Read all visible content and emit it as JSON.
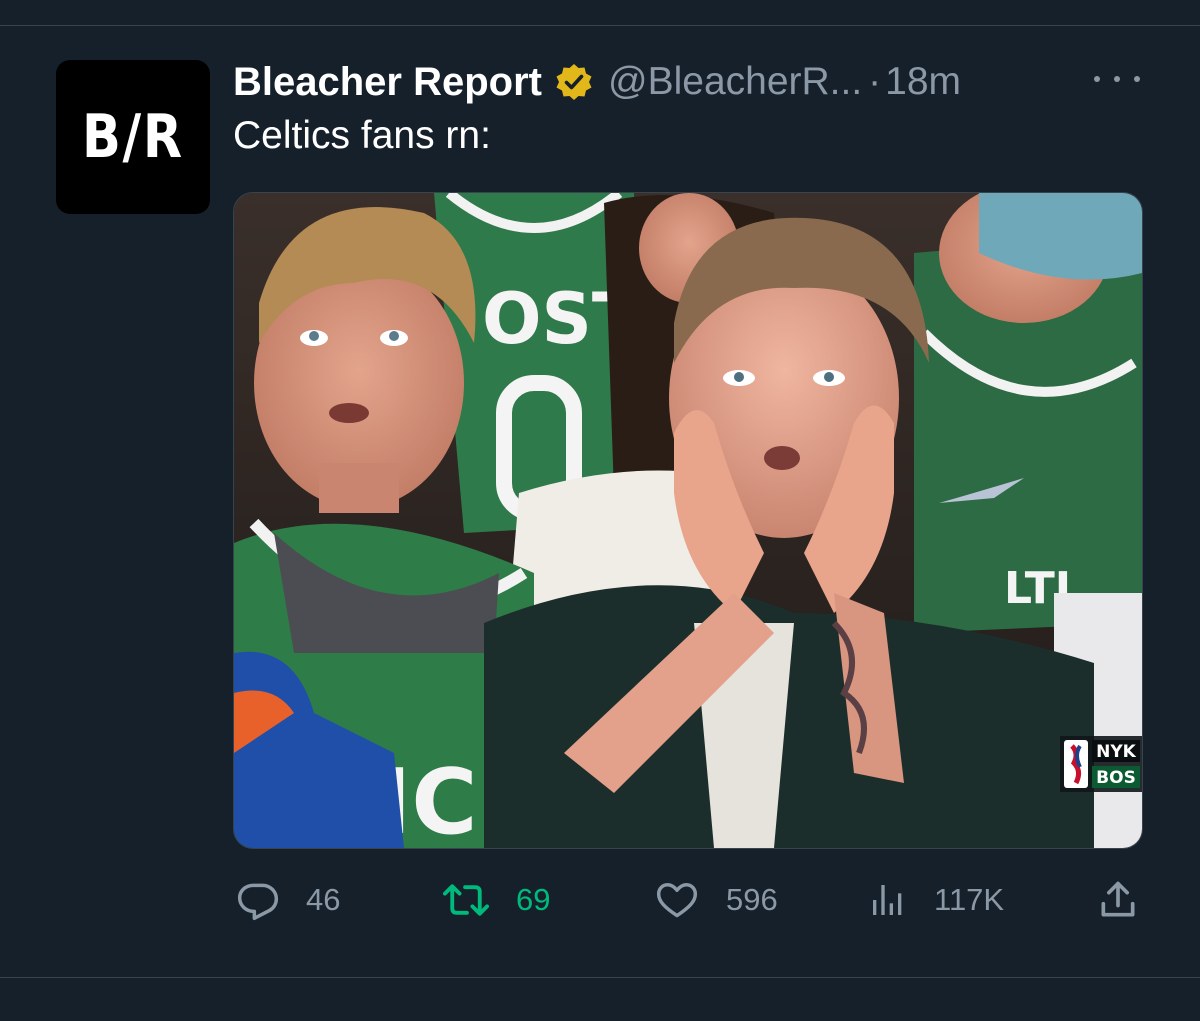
{
  "tweet": {
    "author": {
      "display_name": "Bleacher Report",
      "handle": "@BleacherR...",
      "avatar_text": "B/R"
    },
    "separator": "·",
    "time": "18m",
    "text": "Celtics fans rn:",
    "media": {
      "jersey_text_left": "LTICS",
      "jersey_text_back": "OSTO",
      "jersey_text_right": "LTI",
      "scorebug": {
        "away": "NYK",
        "home": "BOS",
        "league": "NBA"
      }
    },
    "stats": {
      "replies": "46",
      "retweets": "69",
      "likes": "596",
      "views": "117K"
    }
  },
  "colors": {
    "background": "#15202b",
    "divider": "#38444d",
    "secondary_text": "#8b98a5",
    "retweet_active": "#00ba7c",
    "verified_badge": "#e2b719"
  },
  "icons": {
    "verified": "verified-badge-icon",
    "more": "more-options-icon",
    "reply": "reply-icon",
    "retweet": "retweet-icon",
    "like": "heart-icon",
    "views": "views-chart-icon",
    "share": "share-icon"
  }
}
